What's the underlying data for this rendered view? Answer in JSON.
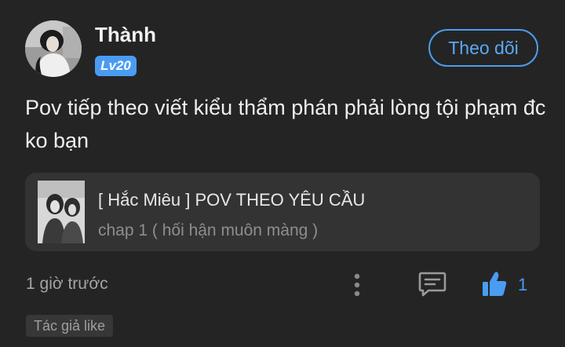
{
  "author": {
    "name": "Thành",
    "level": "Lv20"
  },
  "follow_button_label": "Theo dõi",
  "post": {
    "body": "Pov tiếp theo viết kiểu thẩm phán phải lòng tội phạm đc ko bạn"
  },
  "linked_story": {
    "title": "[ Hắc Miêu ] POV THEO YÊU CẦU",
    "subtitle": "chap 1 ( hối hận muôn màng )"
  },
  "footer": {
    "timestamp": "1 giờ trước",
    "like_count": "1",
    "author_like_tag": "Tác giả like"
  },
  "colors": {
    "background": "#242424",
    "accent": "#4a9cf2",
    "card": "#333333"
  },
  "icons": {
    "more": "vertical-dots-icon",
    "comment": "comment-icon",
    "like": "thumbs-up-icon"
  }
}
